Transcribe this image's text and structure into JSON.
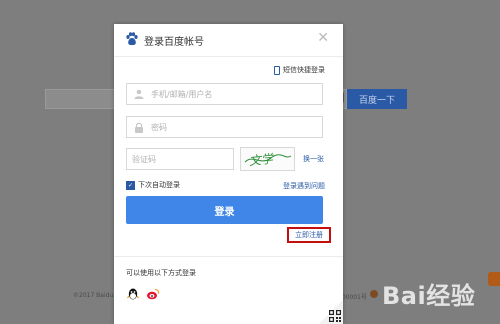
{
  "background": {
    "search_button": "百度一下",
    "copyright": "©2017 Baidu",
    "icp": "000001号",
    "watermark": "Bai经验"
  },
  "dialog": {
    "title": "登录百度帐号",
    "sms_login": "短信快捷登录",
    "username_placeholder": "手机/邮箱/用户名",
    "password_placeholder": "密码",
    "captcha_placeholder": "验证码",
    "captcha_text": "文学",
    "refresh_captcha": "换一张",
    "remember_me": "下次自动登录",
    "login_trouble": "登录遇到问题",
    "login_button": "登录",
    "register_link": "立即注册",
    "alternative_login_label": "可以使用以下方式登录"
  },
  "colors": {
    "primary_blue": "#3f86e8",
    "link_blue": "#2a5aa6",
    "highlight_red": "#c40f0f"
  }
}
